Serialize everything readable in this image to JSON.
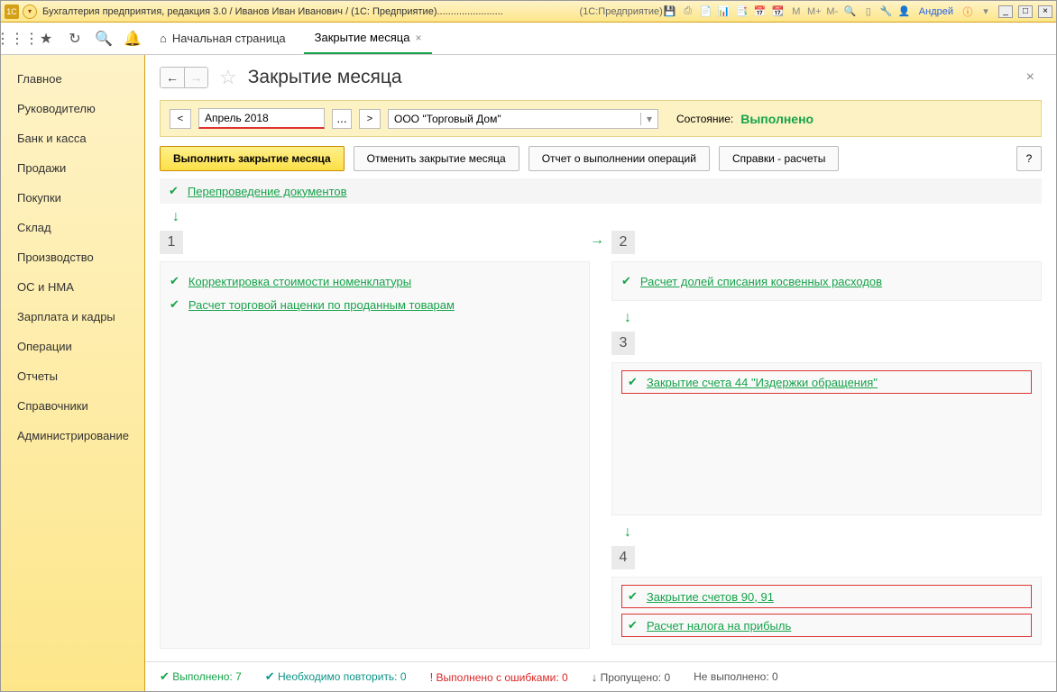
{
  "titlebar": {
    "title": "Бухгалтерия предприятия, редакция 3.0 / Иванов Иван Иванович / (1С: Предприятие)........................",
    "context": "(1С:Предприятие)",
    "user": "Андрей"
  },
  "toolbar": {
    "home_label": "Начальная страница",
    "tab_active": "Закрытие месяца"
  },
  "sidebar": {
    "items": [
      "Главное",
      "Руководителю",
      "Банк и касса",
      "Продажи",
      "Покупки",
      "Склад",
      "Производство",
      "ОС и НМА",
      "Зарплата и кадры",
      "Операции",
      "Отчеты",
      "Справочники",
      "Администрирование"
    ]
  },
  "page": {
    "title": "Закрытие месяца",
    "period": "Апрель 2018",
    "org": "ООО \"Торговый Дом\"",
    "status_label": "Состояние:",
    "status_value": "Выполнено",
    "btn_run": "Выполнить закрытие месяца",
    "btn_cancel": "Отменить закрытие месяца",
    "btn_report": "Отчет о выполнении операций",
    "btn_refs": "Справки - расчеты",
    "help": "?"
  },
  "ops": {
    "header": "Перепроведение документов",
    "stage1": {
      "num": "1",
      "items": [
        "Корректировка стоимости номенклатуры",
        "Расчет торговой наценки по проданным товарам"
      ]
    },
    "stage2": {
      "num": "2",
      "items": [
        "Расчет долей списания косвенных расходов"
      ]
    },
    "stage3": {
      "num": "3",
      "items": [
        "Закрытие счета 44 \"Издержки обращения\""
      ]
    },
    "stage4": {
      "num": "4",
      "items": [
        "Закрытие счетов 90, 91",
        "Расчет налога на прибыль"
      ]
    }
  },
  "footer": {
    "done_label": "Выполнено:",
    "done_val": "7",
    "repeat_label": "Необходимо повторить:",
    "repeat_val": "0",
    "errors_label": "Выполнено с ошибками:",
    "errors_val": "0",
    "skipped_label": "Пропущено:",
    "skipped_val": "0",
    "notdone_label": "Не выполнено:",
    "notdone_val": "0"
  }
}
